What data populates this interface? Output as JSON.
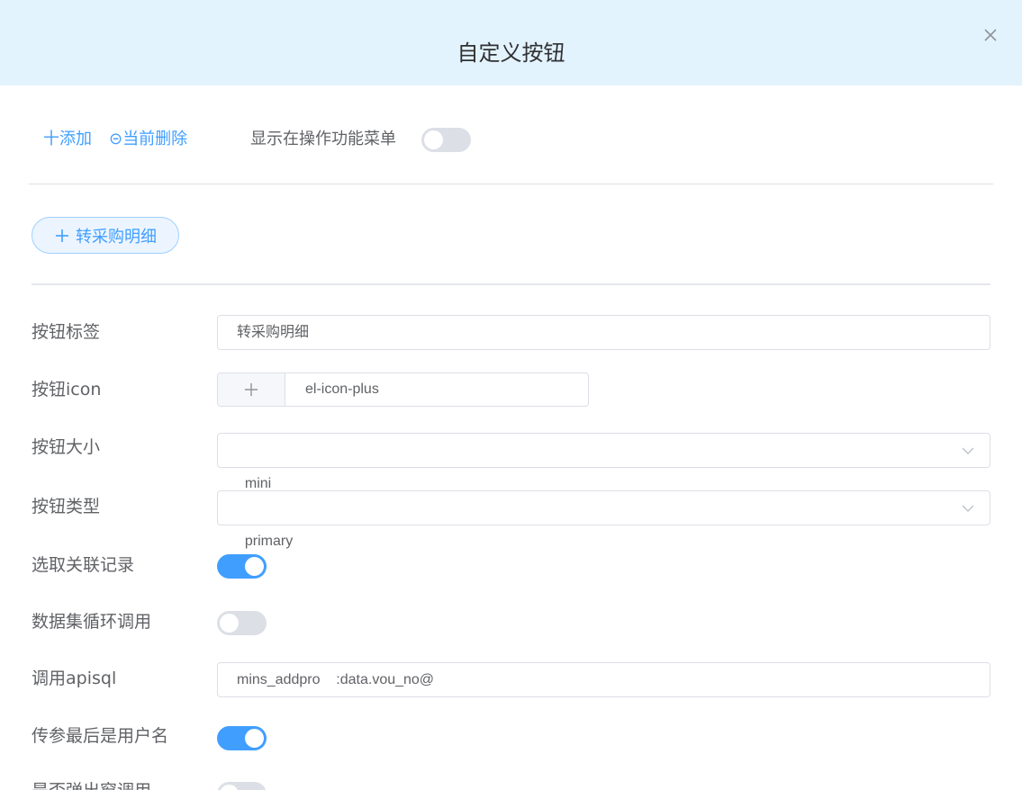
{
  "dialog": {
    "title": "自定义按钮"
  },
  "toolbar": {
    "add_label": "十添加",
    "delete_label": "⊝当前删除",
    "show_in_menu_label": "显示在操作功能菜单",
    "show_in_menu_on": false
  },
  "button_chip": {
    "label": "转采购明细",
    "icon": "plus-icon"
  },
  "form": {
    "label_field": {
      "label": "按钮标签",
      "value": "转采购明细"
    },
    "icon_field": {
      "label": "按钮icon",
      "value": "el-icon-plus",
      "preview_icon": "plus-icon"
    },
    "size_field": {
      "label": "按钮大小",
      "value": "mini"
    },
    "type_field": {
      "label": "按钮类型",
      "value": "primary"
    },
    "select_related": {
      "label": "选取关联记录",
      "on": true
    },
    "dataset_loop": {
      "label": "数据集循环调用",
      "on": false
    },
    "apisql_field": {
      "label": "调用apisql",
      "value": "mins_addpro    :data.vou_no@"
    },
    "last_param_username": {
      "label": "传参最后是用户名",
      "on": true
    },
    "popup_call": {
      "label": "是否弹出窗调用",
      "on": false
    }
  },
  "colors": {
    "accent": "#409eff",
    "header_bg": "#e3f3fd",
    "switch_off": "#dcdfe6"
  }
}
